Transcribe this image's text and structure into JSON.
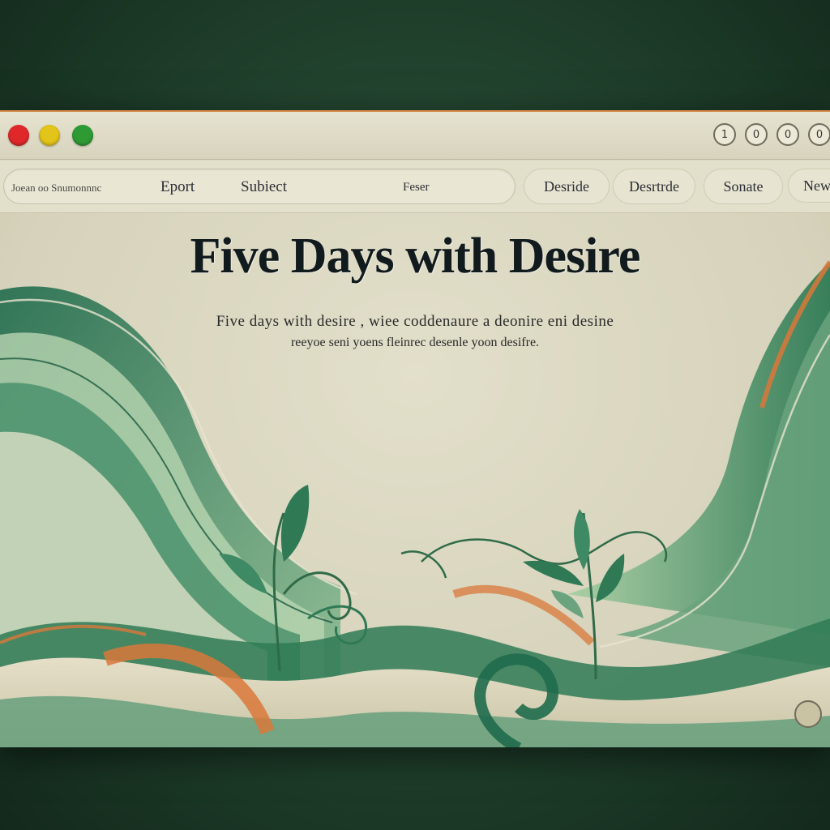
{
  "window": {
    "controls": [
      "1",
      "0",
      "0",
      "0"
    ],
    "traffic_lights": {
      "close": "#e0282a",
      "minimize": "#e3c418",
      "maximize": "#2e9a34"
    }
  },
  "nav": {
    "address_text": "Joean oo Snumonnnc",
    "links": [
      "Eport",
      "Subiect",
      "Feser"
    ],
    "pills": [
      "Desride",
      "Desrtrde",
      "Sonate",
      "Newe"
    ]
  },
  "hero": {
    "title": "Five Days with Desire",
    "subtitle_line1": "Five days with desire , wiee coddenaure a deonire eni desine",
    "subtitle_line2": "reeyoe seni yoens fleinrec desenle yoon desifre."
  },
  "colors": {
    "accent_green": "#2f7a55",
    "accent_orange": "#d9783a",
    "background_cream": "#dcd9c4"
  }
}
